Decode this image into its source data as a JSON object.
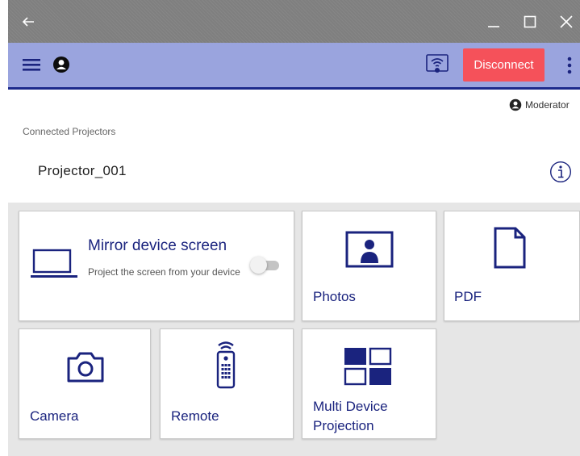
{
  "window": {
    "icons": [
      "back-arrow-icon",
      "minimize-icon",
      "maximize-icon",
      "close-icon"
    ]
  },
  "appbar": {
    "icons": [
      "menu-icon",
      "user-icon",
      "wifi-cast-icon",
      "more-vert-icon"
    ],
    "disconnect_label": "Disconnect",
    "accent_color": "#9aa4de",
    "disconnect_color": "#f5515a"
  },
  "status": {
    "role": "Moderator"
  },
  "connected": {
    "heading": "Connected Projectors",
    "projector_name": "Projector_001"
  },
  "tiles": {
    "mirror": {
      "title": "Mirror device screen",
      "description": "Project the screen from your device",
      "toggle_on": false
    },
    "photos": {
      "label": "Photos"
    },
    "pdf": {
      "label": "PDF"
    },
    "camera": {
      "label": "Camera"
    },
    "remote": {
      "label": "Remote"
    },
    "multi": {
      "label_line1": "Multi Device",
      "label_line2": "Projection"
    }
  }
}
